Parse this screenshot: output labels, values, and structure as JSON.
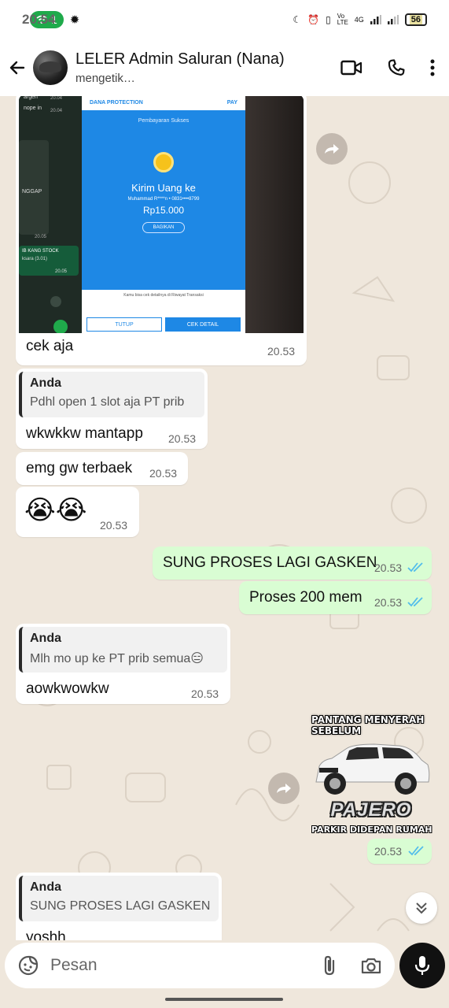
{
  "status": {
    "time": "20.54",
    "hotspot_count": "1",
    "battery": "56",
    "net_label": "4G",
    "volte": "Vo LTE"
  },
  "header": {
    "title": "LELER Admin Saluran (Nana)",
    "subtitle": "mengetik…"
  },
  "image_msg": {
    "brand": "DANA PROTECTION",
    "pay": "PAY",
    "status": "Pembayaran Sukses",
    "heading": "Kirim Uang ke",
    "recipient": "Muhammad R****n • 0831••••8799",
    "amount": "Rp15.000",
    "share": "BAGIKAN",
    "note": "Kamu bisa cek detailnya di Riwayat Transaksi",
    "btn_close": "TUTUP",
    "btn_detail": "CEK DETAIL",
    "side_texts": [
      "argeh",
      "20.04",
      "nope in",
      "20.04",
      "NGGAP",
      "20.05",
      "IB KANG STOCK",
      "ksara (3.01)",
      "20.05"
    ],
    "caption": "cek aja",
    "time": "20.53"
  },
  "messages": [
    {
      "quote_author": "Anda",
      "quote_text": "Pdhl open 1 slot aja PT prib",
      "text": "wkwkkw mantapp",
      "time": "20.53"
    },
    {
      "text": "emg gw terbaek",
      "time": "20.53"
    },
    {
      "text": "😭😭",
      "time": "20.53"
    },
    {
      "text": "SUNG PROSES LAGI GASKEN",
      "time": "20.53"
    },
    {
      "text": "Proses 200 mem",
      "time": "20.53"
    },
    {
      "quote_author": "Anda",
      "quote_text": "Mlh mo up ke PT prib semua😑",
      "text": "aowkwowkw",
      "time": "20.53"
    },
    {
      "quote_author": "Anda",
      "quote_text": "SUNG PROSES LAGI GASKEN",
      "text": "yoshh"
    }
  ],
  "sticker": {
    "top_text": "PANTANG MENYERAH SEBELUM",
    "brand": "PAJERO",
    "bottom_text": "PARKIR DIDEPAN RUMAH",
    "time": "20.53"
  },
  "composer": {
    "placeholder": "Pesan"
  },
  "colors": {
    "outgoing": "#d9fdd3",
    "incoming": "#ffffff",
    "wallpaper": "#efe7dc",
    "read_ticks": "#53bdeb"
  }
}
